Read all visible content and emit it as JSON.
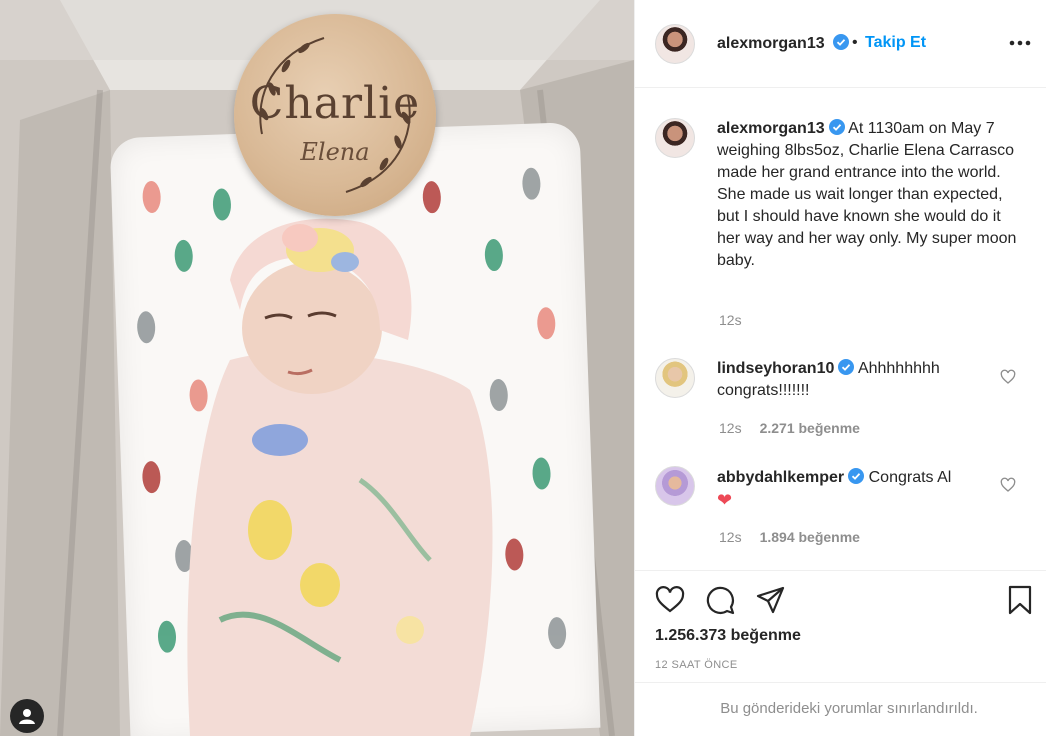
{
  "photo": {
    "sign_name": "Charlie",
    "sign_middle": "Elena",
    "user_badge_icon": "user-tag-icon"
  },
  "header": {
    "username": "alexmorgan13",
    "verified_icon": "verified-badge-icon",
    "dot": "•",
    "follow_label": "Takip Et",
    "more_icon": "more-options-icon"
  },
  "caption": {
    "username": "alexmorgan13",
    "text": "At 1130am on May 7 weighing 8lbs5oz, Charlie Elena Carrasco made her grand entrance into the world. She made us wait longer than expected, but I should have known she would do it her way and her way only. My super moon baby.",
    "time": "12s"
  },
  "comments": [
    {
      "username": "lindseyhoran10",
      "text": "Ahhhhhhhh congrats!!!!!!!",
      "time": "12s",
      "likes": "2.271 beğenme"
    },
    {
      "username": "abbydahlkemper",
      "text": "Congrats Al",
      "emoji": "❤",
      "time": "12s",
      "likes": "1.894 beğenme"
    }
  ],
  "actions": {
    "like_icon": "heart-icon",
    "comment_icon": "comment-icon",
    "share_icon": "share-icon",
    "save_icon": "bookmark-icon",
    "likes_total": "1.256.373 beğenme",
    "time_ago": "12 SAAT ÖNCE",
    "comments_limited": "Bu gönderideki yorumlar sınırlandırıldı."
  },
  "colors": {
    "link_blue": "#0095f6",
    "verified_blue": "#3897f0",
    "muted_gray": "#8e8e8e",
    "heart_red": "#ed4956"
  }
}
